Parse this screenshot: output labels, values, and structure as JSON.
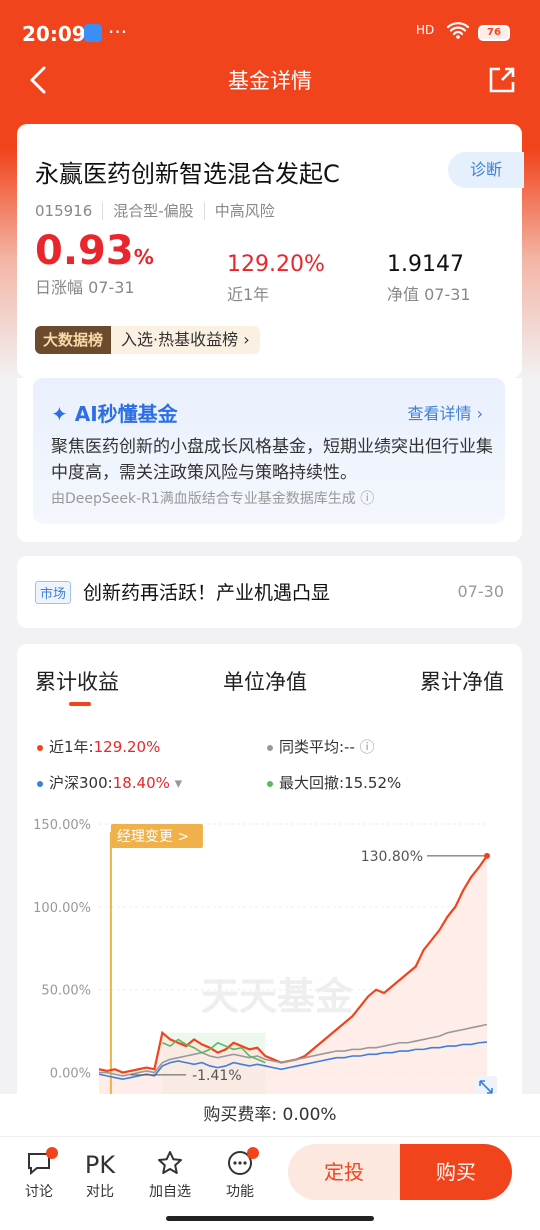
{
  "status": {
    "time": "20:09",
    "dots": "···",
    "signal": "HD",
    "battery": "76"
  },
  "nav": {
    "title": "基金详情"
  },
  "fund": {
    "name": "永赢医药创新智选混合发起C",
    "diagnose": "诊断",
    "code": "015916",
    "type": "混合型-偏股",
    "risk": "中高风险",
    "daily_change": "0.93",
    "daily_change_unit": "%",
    "daily_label": "日涨幅 07-31",
    "year_return": "129.20%",
    "year_label": "近1年",
    "nav": "1.9147",
    "nav_label": "净值 07-31",
    "bigdata_tag": "大数据榜",
    "bigdata_text": "入选·热基收益榜 ›"
  },
  "ai": {
    "title": "AI秒懂基金",
    "more": "查看详情 ›",
    "text": "聚焦医药创新的小盘成长风格基金，短期业绩突出但行业集中度高，需关注政策风险与策略持续性。",
    "source": "由DeepSeek-R1满血版结合专业基金数据库生成 ⓘ"
  },
  "news": {
    "tag": "市场",
    "title": "创新药再活跃！产业机遇凸显",
    "date": "07-30"
  },
  "chart_section": {
    "tabs": [
      "累计收益",
      "单位净值",
      "累计净值"
    ],
    "legend": {
      "fund_label": "近1年:",
      "fund_value": "129.20%",
      "peer_label": "同类平均:--",
      "peer_info": "ⓘ",
      "index_label": "沪深300:",
      "index_value": "18.40%",
      "index_arrow": "▾",
      "drawdown_label": "最大回撤:",
      "drawdown_value": "15.52%"
    },
    "manager_change": "经理变更 >",
    "max_label": "130.80%",
    "min_label": "-1.41%",
    "watermark": "天天基金"
  },
  "chart_data": {
    "type": "line",
    "ylim": [
      -25,
      150
    ],
    "yticks": [
      "150.00%",
      "100.00%",
      "50.00%",
      "0.00%"
    ],
    "ytick_values": [
      150,
      100,
      50,
      0
    ],
    "series": [
      {
        "name": "近1年",
        "color": "#f1441d",
        "values": [
          2,
          1,
          2,
          0,
          1,
          2,
          3,
          2,
          24,
          20,
          18,
          16,
          20,
          17,
          15,
          12,
          14,
          18,
          16,
          14,
          15,
          10,
          8,
          6,
          7,
          8,
          10,
          14,
          18,
          22,
          26,
          30,
          34,
          40,
          46,
          50,
          48,
          52,
          56,
          60,
          64,
          74,
          80,
          86,
          94,
          100,
          110,
          118,
          124,
          130.8
        ]
      },
      {
        "name": "同类平均",
        "color": "#999999",
        "values": [
          0,
          0,
          -1,
          -2,
          -1,
          0,
          1,
          0,
          6,
          8,
          9,
          10,
          11,
          12,
          10,
          9,
          10,
          11,
          10,
          9,
          10,
          8,
          7,
          6,
          7,
          8,
          9,
          10,
          11,
          12,
          13,
          13,
          14,
          14,
          15,
          15,
          16,
          17,
          18,
          18,
          19,
          20,
          21,
          22,
          24,
          25,
          26,
          27,
          28,
          29
        ]
      },
      {
        "name": "沪深300",
        "color": "#3f7fd8",
        "values": [
          -1,
          -2,
          -3,
          -4,
          -3,
          -2,
          -1,
          -2,
          4,
          6,
          7,
          6,
          5,
          6,
          4,
          3,
          4,
          6,
          5,
          4,
          5,
          4,
          3,
          2,
          3,
          4,
          5,
          6,
          7,
          8,
          9,
          9,
          10,
          10,
          11,
          11,
          12,
          12,
          13,
          13,
          14,
          14,
          15,
          15,
          16,
          16,
          17,
          17,
          18,
          18.4
        ]
      },
      {
        "name": "最大回撤",
        "color": "#5cb85c",
        "values": [
          18,
          16,
          20,
          17,
          15,
          12,
          14,
          18,
          16,
          14,
          15,
          10,
          8,
          6
        ]
      }
    ]
  }
}
